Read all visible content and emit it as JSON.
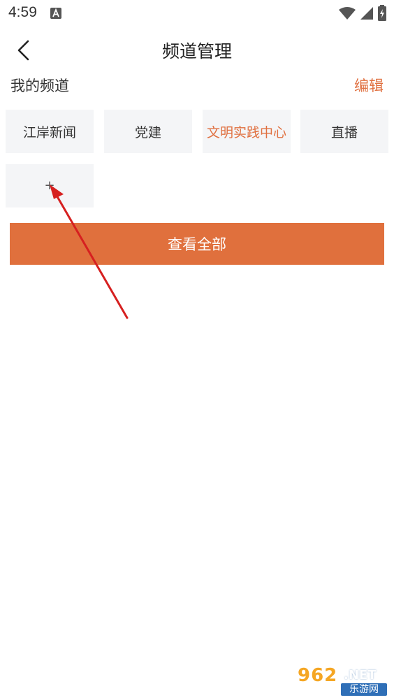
{
  "status_bar": {
    "time": "4:59",
    "icons": [
      "a-notification-icon",
      "wifi-icon",
      "signal-icon",
      "battery-icon"
    ]
  },
  "header": {
    "title": "频道管理",
    "back_icon": "chevron-left-icon"
  },
  "my_channels": {
    "label": "我的频道",
    "edit_label": "编辑",
    "items": [
      {
        "label": "江岸新闻",
        "active": false
      },
      {
        "label": "党建",
        "active": false
      },
      {
        "label": "文明实践中心",
        "active": true
      },
      {
        "label": "直播",
        "active": false
      }
    ],
    "add_tile_label": "+"
  },
  "view_all_button": {
    "label": "查看全部"
  },
  "watermark": {
    "brand": "962",
    "net": ".NET",
    "sub": "乐游网"
  },
  "colors": {
    "accent": "#e0703d",
    "tile_bg": "#f4f5f7",
    "annotation_arrow": "#d62020"
  }
}
